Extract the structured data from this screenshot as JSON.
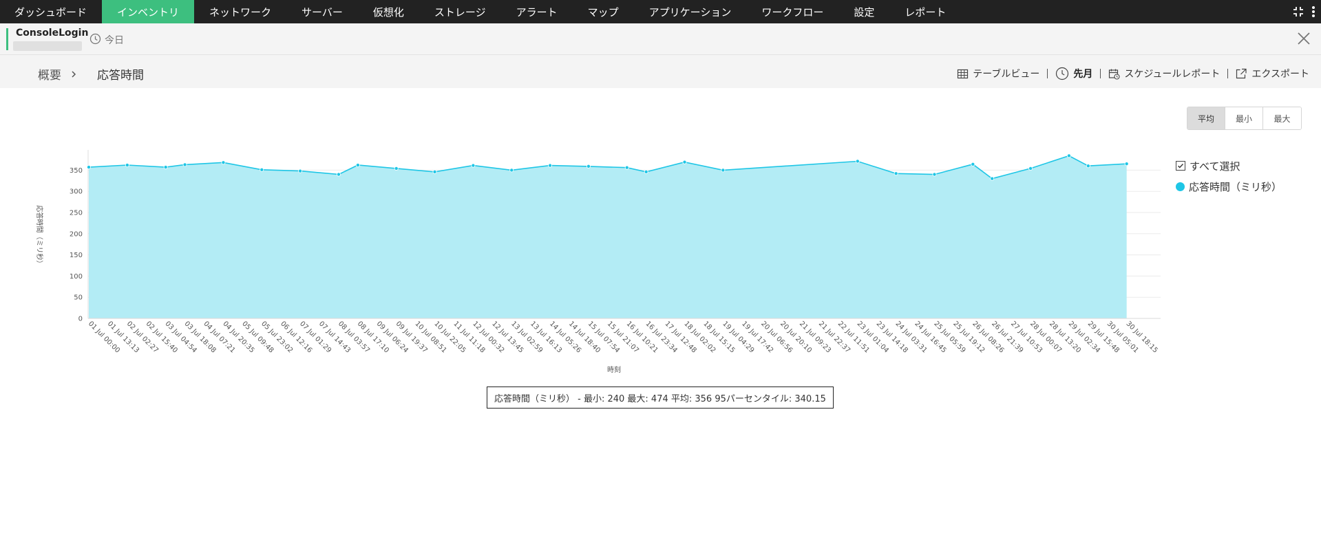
{
  "nav": {
    "items": [
      "ダッシュボード",
      "インベントリ",
      "ネットワーク",
      "サーバー",
      "仮想化",
      "ストレージ",
      "アラート",
      "マップ",
      "アプリケーション",
      "ワークフロー",
      "設定",
      "レポート"
    ],
    "active_index": 1
  },
  "monitor": {
    "name": "ConsoleLogin",
    "date_label": "今日"
  },
  "breadcrumb": {
    "home": "概要",
    "current": "応答時間"
  },
  "toolbar": {
    "table_view": "テーブルビュー",
    "period": "先月",
    "schedule_report": "スケジュールレポート",
    "export": "エクスポート"
  },
  "toggle": {
    "avg": "平均",
    "min": "最小",
    "max": "最大",
    "selected": "avg"
  },
  "legend": {
    "select_all": "すべて選択",
    "series_name": "応答時間（ミリ秒）"
  },
  "stats_text": "応答時間（ミリ秒） - 最小: 240 最大: 474 平均: 356 95パーセンタイル: 340.15",
  "colors": {
    "nav_bg": "#222222",
    "nav_active": "#3dbf7f",
    "series_line": "#1ec6e6",
    "series_fill": "#b3ecf5"
  },
  "chart_data": {
    "type": "area",
    "xlabel": "時刻",
    "ylabel": "応答時間（ミリ秒）",
    "ylim": [
      0,
      350
    ],
    "yticks": [
      0,
      50,
      100,
      150,
      200,
      250,
      300,
      350
    ],
    "grid": true,
    "legend_position": "right",
    "x": [
      "01 Jul 00:00",
      "01 Jul 13:13",
      "02 Jul 02:27",
      "02 Jul 15:40",
      "03 Jul 04:54",
      "03 Jul 18:08",
      "04 Jul 07:21",
      "04 Jul 20:35",
      "05 Jul 09:48",
      "05 Jul 23:02",
      "06 Jul 12:16",
      "07 Jul 01:29",
      "07 Jul 14:43",
      "08 Jul 03:57",
      "08 Jul 17:10",
      "09 Jul 06:24",
      "09 Jul 19:37",
      "10 Jul 08:51",
      "10 Jul 22:05",
      "11 Jul 11:18",
      "12 Jul 00:32",
      "12 Jul 13:45",
      "13 Jul 02:59",
      "13 Jul 16:13",
      "14 Jul 05:26",
      "14 Jul 18:40",
      "15 Jul 07:54",
      "15 Jul 21:07",
      "16 Jul 10:21",
      "16 Jul 23:34",
      "17 Jul 12:48",
      "18 Jul 02:02",
      "18 Jul 15:15",
      "19 Jul 04:29",
      "19 Jul 17:42",
      "20 Jul 06:56",
      "20 Jul 20:10",
      "21 Jul 09:23",
      "21 Jul 22:37",
      "22 Jul 11:51",
      "23 Jul 01:04",
      "23 Jul 14:18",
      "24 Jul 03:31",
      "24 Jul 16:45",
      "25 Jul 05:59",
      "25 Jul 19:12",
      "26 Jul 08:26",
      "26 Jul 21:39",
      "27 Jul 10:53",
      "28 Jul 00:07",
      "28 Jul 13:20",
      "29 Jul 02:34",
      "29 Jul 15:48",
      "30 Jul 05:01",
      "30 Jul 18:15"
    ],
    "series": [
      {
        "name": "応答時間（ミリ秒）",
        "points": [
          {
            "x": "01 Jul 00:00",
            "y": 357
          },
          {
            "x": "02 Jul 02:27",
            "y": 362
          },
          {
            "x": "03 Jul 04:54",
            "y": 357
          },
          {
            "x": "03 Jul 18:08",
            "y": 363
          },
          {
            "x": "04 Jul 20:35",
            "y": 368
          },
          {
            "x": "05 Jul 23:02",
            "y": 351
          },
          {
            "x": "07 Jul 01:29",
            "y": 348
          },
          {
            "x": "08 Jul 03:57",
            "y": 340
          },
          {
            "x": "08 Jul 17:10",
            "y": 362
          },
          {
            "x": "09 Jul 19:37",
            "y": 354
          },
          {
            "x": "10 Jul 22:05",
            "y": 346
          },
          {
            "x": "12 Jul 00:32",
            "y": 361
          },
          {
            "x": "13 Jul 02:59",
            "y": 350
          },
          {
            "x": "14 Jul 05:26",
            "y": 361
          },
          {
            "x": "15 Jul 07:54",
            "y": 359
          },
          {
            "x": "16 Jul 10:21",
            "y": 356
          },
          {
            "x": "16 Jul 23:34",
            "y": 346
          },
          {
            "x": "18 Jul 02:02",
            "y": 369
          },
          {
            "x": "19 Jul 04:29",
            "y": 350
          },
          {
            "x": "23 Jul 01:04",
            "y": 371
          },
          {
            "x": "24 Jul 03:31",
            "y": 342
          },
          {
            "x": "25 Jul 05:59",
            "y": 340
          },
          {
            "x": "26 Jul 08:26",
            "y": 364
          },
          {
            "x": "26 Jul 21:39",
            "y": 330
          },
          {
            "x": "28 Jul 00:07",
            "y": 354
          },
          {
            "x": "29 Jul 02:34",
            "y": 384
          },
          {
            "x": "29 Jul 15:48",
            "y": 360
          },
          {
            "x": "30 Jul 18:15",
            "y": 365
          }
        ]
      }
    ]
  }
}
